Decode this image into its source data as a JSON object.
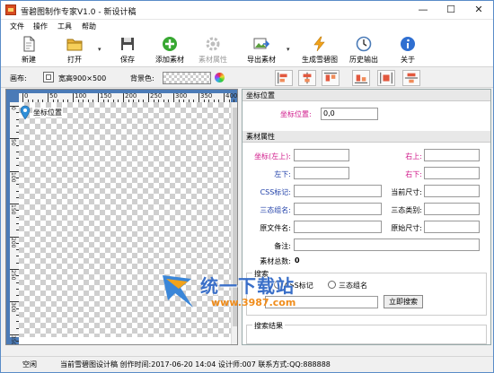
{
  "window": {
    "title": "雪碧图制作专家V1.0 - 新设计稿",
    "controls": {
      "minimize": "—",
      "maximize": "☐",
      "close": "✕"
    }
  },
  "menubar": {
    "items": [
      {
        "label": "文件"
      },
      {
        "label": "操作"
      },
      {
        "label": "工具"
      },
      {
        "label": "帮助"
      }
    ]
  },
  "toolbar": {
    "new_label": "新建",
    "open_label": "打开",
    "save_label": "保存",
    "add_asset_label": "添加素材",
    "asset_props_label": "素材属性",
    "export_label": "导出素材",
    "generate_label": "生成雪碧图",
    "history_label": "历史输出",
    "about_label": "关于",
    "dropdown_glyph": "▾",
    "colors": {
      "green": "#38a832",
      "blue": "#2f6fd1",
      "orange": "#f2a31b",
      "disabled": "#bdbdbd"
    }
  },
  "options": {
    "canvas_label": "画布:",
    "canvas_size": "宽高900×500",
    "bg_label": "背景色:"
  },
  "canvas": {
    "ruler_top_ticks": [
      "0",
      "50",
      "100",
      "150",
      "200",
      "250",
      "300",
      "350",
      "400"
    ],
    "ruler_left_ticks": [
      "0",
      "50",
      "100",
      "150",
      "200",
      "250",
      "300",
      "350"
    ],
    "marker_label": "坐标位置"
  },
  "coord_section": {
    "title": "坐标位置",
    "pos_label": "坐标位置:",
    "pos_value": "0,0"
  },
  "props_section": {
    "title": "素材属性",
    "coord_label": "坐标(左上):",
    "coord_value": "",
    "topright_label": "右上:",
    "topright_value": "",
    "bottomleft_label": "左下:",
    "bottomleft_value": "",
    "bottomright_label": "右下:",
    "bottomright_value": "",
    "css_label": "CSS标记:",
    "css_value": "",
    "cursize_label": "当前尺寸:",
    "cursize_value": "",
    "group_label": "三态组名:",
    "group_value": "",
    "type_label": "三态类别:",
    "type_value": "",
    "orig_name_label": "原文件名:",
    "orig_name_value": "",
    "orig_size_label": "原始尺寸:",
    "orig_size_value": "",
    "note_label": "备注:",
    "note_value": "",
    "total_label": "素材总数:",
    "total_value": "0"
  },
  "search_section": {
    "title": "搜索",
    "radio_css": "CSS标记",
    "radio_group": "三态组名",
    "search_value": "",
    "search_button": "立即搜索",
    "results_title": "搜索结果"
  },
  "statusbar": {
    "state": "空闲",
    "info": "当前雪碧图设计稿 创作时间:2017-06-20 14:04 设计师:007 联系方式:QQ:888888"
  },
  "watermark": {
    "text": "统一下载站",
    "url": "www.3987.com"
  },
  "accent": "#4b7bb7"
}
